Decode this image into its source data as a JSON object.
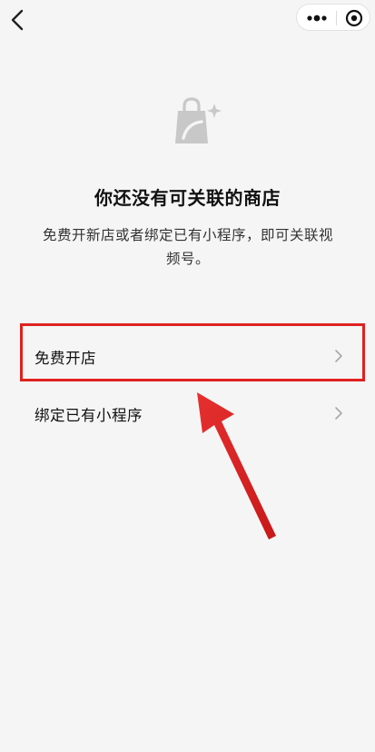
{
  "nav": {
    "back_icon": "chevron-left-icon",
    "more_icon": "more-dots-icon",
    "close_icon": "target-circle-icon"
  },
  "empty_state": {
    "icon": "shopping-bag-sparkle-icon",
    "title": "你还没有可关联的商店",
    "description": "免费开新店或者绑定已有小程序，即可关联视频号。"
  },
  "options": [
    {
      "label": "免费开店",
      "icon": "chevron-right-icon"
    },
    {
      "label": "绑定已有小程序",
      "icon": "chevron-right-icon"
    }
  ],
  "annotation": {
    "highlight_color": "#e02020",
    "arrow_color": "#e02020"
  },
  "colors": {
    "background": "#f5f5f5",
    "text": "#111111",
    "icon_gray": "#c8c8c8"
  }
}
